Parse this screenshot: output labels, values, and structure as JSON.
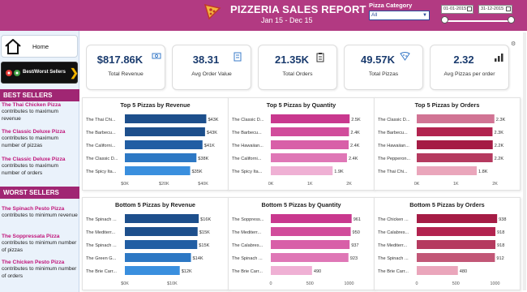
{
  "header": {
    "title": "PIZZERIA SALES REPORT",
    "subtitle": "Jan 15 - Dec 15",
    "category_label": "Pizza Category",
    "category_value": "All",
    "date_start": "01-01-2015",
    "date_end": "31-12-2015",
    "bg_color": "#b23a82"
  },
  "sidebar": {
    "home_label": "Home",
    "best_worst_label": "Best/Worst Sellers",
    "best_sellers_heading": "BEST SELLERS",
    "worst_sellers_heading": "WORST SELLERS",
    "best_items": [
      {
        "name": "The Thai Chicken Pizza",
        "desc": "contributes to maximum revenue"
      },
      {
        "name": "The Classic Deluxe Pizza",
        "desc": "contributes to maximum number of pizzas"
      },
      {
        "name": "The Classic Deluxe Pizza",
        "desc": "contributes to maximum number of orders"
      }
    ],
    "worst_items": [
      {
        "name": "The Spinach Pesto Pizza",
        "desc": "contributes to minimum revenue"
      },
      {
        "name": "The Soppressata Pizza",
        "desc": "contributes to minimum number of pizzas"
      },
      {
        "name": "The Chicken Pesto Pizza",
        "desc": "contributes to minimum number of orders"
      }
    ]
  },
  "kpis": [
    {
      "value": "$817.86K",
      "label": "Total Revenue",
      "icon": "money-icon"
    },
    {
      "value": "38.31",
      "label": "Avg Order Value",
      "icon": "receipt-icon"
    },
    {
      "value": "21.35K",
      "label": "Total Orders",
      "icon": "clipboard-icon"
    },
    {
      "value": "49.57K",
      "label": "Total Pizzas",
      "icon": "pizza-icon"
    },
    {
      "value": "2.32",
      "label": "Avg Pizzas per order",
      "icon": "bar-chart-icon"
    }
  ],
  "chart_data": [
    {
      "type": "bar",
      "orientation": "horizontal",
      "title": "Top 5 Pizzas by Revenue",
      "categories": [
        "The Thai Chi...",
        "The Barbecu...",
        "The Californi...",
        "The Classic D...",
        "The Spicy Ita..."
      ],
      "values": [
        43434,
        42768,
        41410,
        38180,
        34832
      ],
      "data_labels": [
        "$43K",
        "$43K",
        "$41K",
        "$38K",
        "$35K"
      ],
      "ticks": [
        "$0K",
        "$20K",
        "$40K"
      ],
      "xlim": [
        0,
        48000
      ],
      "colors": [
        "#1d4f8c",
        "#1d4f8c",
        "#215ea3",
        "#2d78c4",
        "#3a8fde"
      ]
    },
    {
      "type": "bar",
      "orientation": "horizontal",
      "title": "Top 5 Pizzas by Quantity",
      "categories": [
        "The Classic D...",
        "The Barbecu...",
        "The Hawaiian...",
        "The Californi...",
        "The Spicy Ita..."
      ],
      "values": [
        2453,
        2432,
        2422,
        2370,
        1924
      ],
      "data_labels": [
        "2.5K",
        "2.4K",
        "2.4K",
        "2.4K",
        "1.9K"
      ],
      "ticks": [
        "0K",
        "1K",
        "2K"
      ],
      "xlim": [
        0,
        2800
      ],
      "colors": [
        "#c9388e",
        "#d14c9b",
        "#d85fa8",
        "#df77b6",
        "#efb0d4"
      ]
    },
    {
      "type": "bar",
      "orientation": "horizontal",
      "title": "Top 5 Pizzas by Orders",
      "categories": [
        "The Classic D...",
        "The Barbecu...",
        "The Hawaiian...",
        "The Pepperon...",
        "The Thai Chi..."
      ],
      "values": [
        2329,
        2273,
        2280,
        2278,
        1800
      ],
      "data_labels": [
        "2.3K",
        "2.3K",
        "2.2K",
        "2.2K",
        "1.8K"
      ],
      "ticks": [
        "0K",
        "1K",
        "2K"
      ],
      "xlim": [
        0,
        2700
      ],
      "colors": [
        "#d17494",
        "#b2234f",
        "#a51c45",
        "#b53a5f",
        "#eaa6bb"
      ]
    },
    {
      "type": "bar",
      "orientation": "horizontal",
      "title": "Bottom 5 Pizzas by Revenue",
      "categories": [
        "The Spinach ...",
        "The Mediterr...",
        "The Spinach ...",
        "The Green G...",
        "The Brie Carr..."
      ],
      "values": [
        15596,
        15360,
        15277,
        13956,
        11588
      ],
      "data_labels": [
        "$16K",
        "$15K",
        "$15K",
        "$14K",
        "$12K"
      ],
      "ticks": [
        "$0K",
        "$10K"
      ],
      "xlim": [
        0,
        19000
      ],
      "colors": [
        "#1d4f8c",
        "#1d4f8c",
        "#215ea3",
        "#2d78c4",
        "#3a8fde"
      ]
    },
    {
      "type": "bar",
      "orientation": "horizontal",
      "title": "Bottom 5 Pizzas by Quantity",
      "categories": [
        "The Soppress...",
        "The Mediterr...",
        "The Calabres...",
        "The Spinach ...",
        "The Brie Carr..."
      ],
      "values": [
        961,
        950,
        937,
        923,
        490
      ],
      "data_labels": [
        "961",
        "950",
        "937",
        "923",
        "490"
      ],
      "ticks": [
        "0",
        "500",
        "1000"
      ],
      "xlim": [
        0,
        1070
      ],
      "colors": [
        "#c9388e",
        "#d14c9b",
        "#d85fa8",
        "#df77b6",
        "#efb0d4"
      ]
    },
    {
      "type": "bar",
      "orientation": "horizontal",
      "title": "Bottom 5 Pizzas by Orders",
      "categories": [
        "The Chicken ...",
        "The Calabres...",
        "The Mediterr...",
        "The Spinach ...",
        "The Brie Carr..."
      ],
      "values": [
        938,
        918,
        918,
        912,
        480
      ],
      "data_labels": [
        "938",
        "918",
        "918",
        "912",
        "480"
      ],
      "ticks": [
        "0",
        "500",
        "1000"
      ],
      "xlim": [
        0,
        1050
      ],
      "colors": [
        "#a51c45",
        "#b2234f",
        "#b53a5f",
        "#c25777",
        "#eaa6bb"
      ]
    }
  ]
}
